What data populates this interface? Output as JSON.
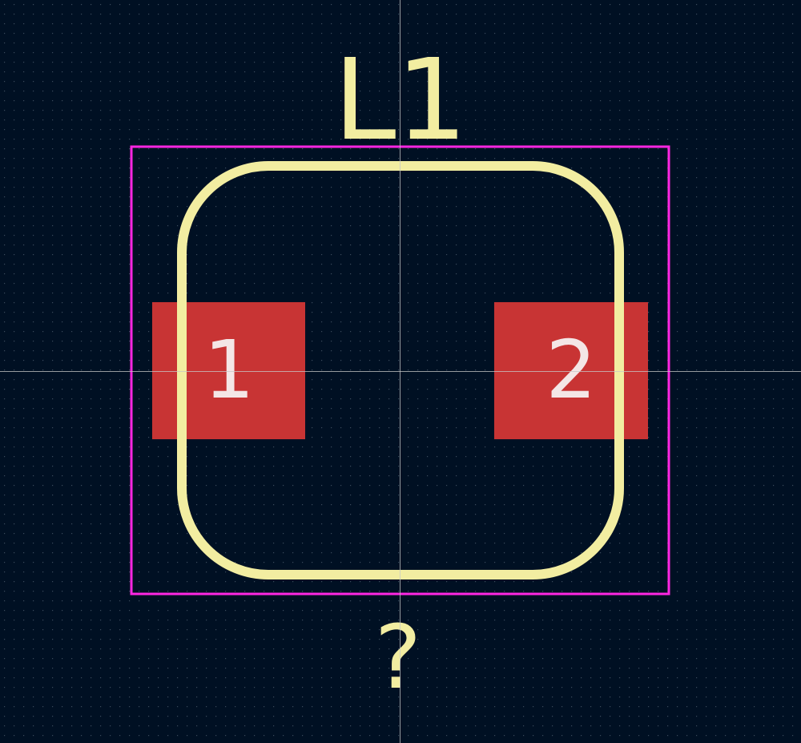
{
  "footprint": {
    "reference": "L1",
    "value": "?",
    "pads": [
      {
        "number": "1"
      },
      {
        "number": "2"
      }
    ]
  },
  "colors": {
    "background": "#001023",
    "grid_dot": "#3a4a5c",
    "silkscreen": "#f2eda1",
    "courtyard": "#ff26e2",
    "pad": "#c83434",
    "pad_number": "#f4e6e6",
    "crosshair": "#c8c8c8"
  }
}
